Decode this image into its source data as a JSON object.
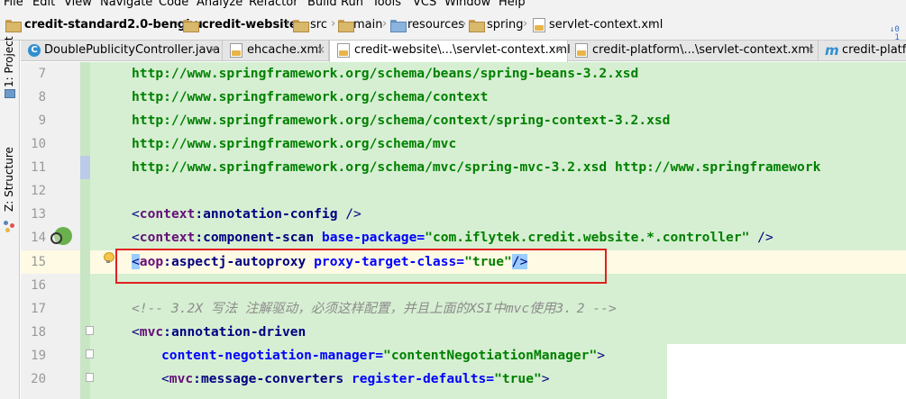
{
  "menu": [
    "File",
    "Edit",
    "View",
    "Navigate",
    "Code",
    "Analyze",
    "Refactor",
    "Build",
    "Run",
    "Tools",
    "VCS",
    "Window",
    "Help"
  ],
  "breadcrumb": [
    "credit-standard2.0-bengbu",
    "credit-website",
    "src",
    "main",
    "resources",
    "spring",
    "servlet-context.xml"
  ],
  "left_tools": {
    "project": "1: Project",
    "structure": "Z: Structure"
  },
  "tabs": [
    {
      "label": "DoublePublicityController.java",
      "icon": "java-class-icon",
      "active": false
    },
    {
      "label": "ehcache.xml",
      "icon": "xml-file-icon",
      "active": false
    },
    {
      "label": "credit-website\\...\\servlet-context.xml",
      "icon": "xml-file-icon",
      "active": true
    },
    {
      "label": "credit-platform\\...\\servlet-context.xml",
      "icon": "xml-file-icon",
      "active": false
    },
    {
      "label": "credit-platform",
      "icon": "maven-icon",
      "active": false
    }
  ],
  "tab_close": "×",
  "editor": {
    "line_numbers": [
      "7",
      "8",
      "9",
      "10",
      "11",
      "12",
      "13",
      "14",
      "15",
      "16",
      "17",
      "18",
      "19",
      "20"
    ],
    "urls": [
      "http://www.springframework.org/schema/beans/spring-beans-3.2.xsd",
      "http://www.springframework.org/schema/context",
      "http://www.springframework.org/schema/context/spring-context-3.2.xsd",
      "http://www.springframework.org/schema/mvc",
      "http://www.springframework.org/schema/mvc/spring-mvc-3.2.xsd http://www.springframework"
    ],
    "l13": {
      "open": "<",
      "ns": "context",
      "colon": ":",
      "tag": "annotation-config",
      "close": " />"
    },
    "l14": {
      "open": "<",
      "ns": "context",
      "colon": ":",
      "tag": "component-scan",
      "sp": " ",
      "attr": "base-package",
      "eq": "=",
      "val": "\"com.iflytek.credit.website.*.controller\"",
      "close": " />"
    },
    "l15": {
      "open": "<",
      "ns": "aop",
      "colon": ":",
      "tag": "aspectj-autoproxy",
      "sp": " ",
      "attr": "proxy-target-class",
      "eq": "=",
      "val": "\"true\"",
      "close": "/>"
    },
    "l17": "<!-- 3.2X 写法 注解驱动，必须这样配置，并且上面的XSI中mvc使用3．2 -->",
    "l18": {
      "open": "<",
      "ns": "mvc",
      "colon": ":",
      "tag": "annotation-driven"
    },
    "l19": {
      "attr": "content-negotiation-manager",
      "eq": "=",
      "val": "\"contentNegotiationManager\"",
      "close": ">"
    },
    "l20": {
      "open": "<",
      "ns": "mvc",
      "colon": ":",
      "tag": "message-converters",
      "sp": " ",
      "attr": "register-defaults",
      "eq": "=",
      "val": "\"true\"",
      "close": ">"
    }
  }
}
